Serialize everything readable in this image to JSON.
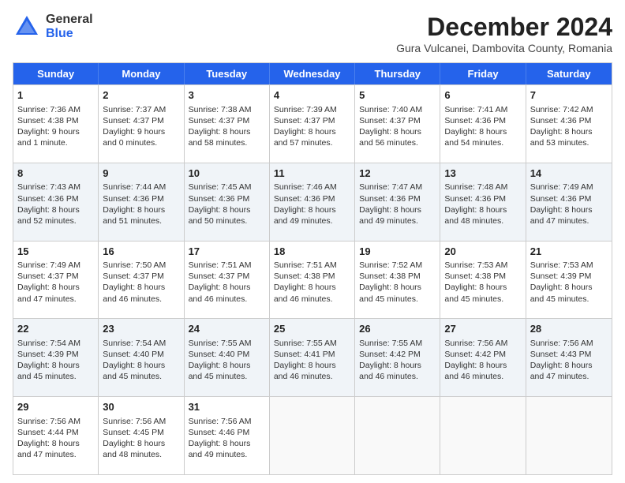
{
  "logo": {
    "general": "General",
    "blue": "Blue"
  },
  "title": "December 2024",
  "subtitle": "Gura Vulcanei, Dambovita County, Romania",
  "days": [
    "Sunday",
    "Monday",
    "Tuesday",
    "Wednesday",
    "Thursday",
    "Friday",
    "Saturday"
  ],
  "weeks": [
    [
      {
        "num": "1",
        "info": "Sunrise: 7:36 AM\nSunset: 4:38 PM\nDaylight: 9 hours\nand 1 minute.",
        "shade": false
      },
      {
        "num": "2",
        "info": "Sunrise: 7:37 AM\nSunset: 4:37 PM\nDaylight: 9 hours\nand 0 minutes.",
        "shade": false
      },
      {
        "num": "3",
        "info": "Sunrise: 7:38 AM\nSunset: 4:37 PM\nDaylight: 8 hours\nand 58 minutes.",
        "shade": false
      },
      {
        "num": "4",
        "info": "Sunrise: 7:39 AM\nSunset: 4:37 PM\nDaylight: 8 hours\nand 57 minutes.",
        "shade": false
      },
      {
        "num": "5",
        "info": "Sunrise: 7:40 AM\nSunset: 4:37 PM\nDaylight: 8 hours\nand 56 minutes.",
        "shade": false
      },
      {
        "num": "6",
        "info": "Sunrise: 7:41 AM\nSunset: 4:36 PM\nDaylight: 8 hours\nand 54 minutes.",
        "shade": false
      },
      {
        "num": "7",
        "info": "Sunrise: 7:42 AM\nSunset: 4:36 PM\nDaylight: 8 hours\nand 53 minutes.",
        "shade": false
      }
    ],
    [
      {
        "num": "8",
        "info": "Sunrise: 7:43 AM\nSunset: 4:36 PM\nDaylight: 8 hours\nand 52 minutes.",
        "shade": true
      },
      {
        "num": "9",
        "info": "Sunrise: 7:44 AM\nSunset: 4:36 PM\nDaylight: 8 hours\nand 51 minutes.",
        "shade": true
      },
      {
        "num": "10",
        "info": "Sunrise: 7:45 AM\nSunset: 4:36 PM\nDaylight: 8 hours\nand 50 minutes.",
        "shade": true
      },
      {
        "num": "11",
        "info": "Sunrise: 7:46 AM\nSunset: 4:36 PM\nDaylight: 8 hours\nand 49 minutes.",
        "shade": true
      },
      {
        "num": "12",
        "info": "Sunrise: 7:47 AM\nSunset: 4:36 PM\nDaylight: 8 hours\nand 49 minutes.",
        "shade": true
      },
      {
        "num": "13",
        "info": "Sunrise: 7:48 AM\nSunset: 4:36 PM\nDaylight: 8 hours\nand 48 minutes.",
        "shade": true
      },
      {
        "num": "14",
        "info": "Sunrise: 7:49 AM\nSunset: 4:36 PM\nDaylight: 8 hours\nand 47 minutes.",
        "shade": true
      }
    ],
    [
      {
        "num": "15",
        "info": "Sunrise: 7:49 AM\nSunset: 4:37 PM\nDaylight: 8 hours\nand 47 minutes.",
        "shade": false
      },
      {
        "num": "16",
        "info": "Sunrise: 7:50 AM\nSunset: 4:37 PM\nDaylight: 8 hours\nand 46 minutes.",
        "shade": false
      },
      {
        "num": "17",
        "info": "Sunrise: 7:51 AM\nSunset: 4:37 PM\nDaylight: 8 hours\nand 46 minutes.",
        "shade": false
      },
      {
        "num": "18",
        "info": "Sunrise: 7:51 AM\nSunset: 4:38 PM\nDaylight: 8 hours\nand 46 minutes.",
        "shade": false
      },
      {
        "num": "19",
        "info": "Sunrise: 7:52 AM\nSunset: 4:38 PM\nDaylight: 8 hours\nand 45 minutes.",
        "shade": false
      },
      {
        "num": "20",
        "info": "Sunrise: 7:53 AM\nSunset: 4:38 PM\nDaylight: 8 hours\nand 45 minutes.",
        "shade": false
      },
      {
        "num": "21",
        "info": "Sunrise: 7:53 AM\nSunset: 4:39 PM\nDaylight: 8 hours\nand 45 minutes.",
        "shade": false
      }
    ],
    [
      {
        "num": "22",
        "info": "Sunrise: 7:54 AM\nSunset: 4:39 PM\nDaylight: 8 hours\nand 45 minutes.",
        "shade": true
      },
      {
        "num": "23",
        "info": "Sunrise: 7:54 AM\nSunset: 4:40 PM\nDaylight: 8 hours\nand 45 minutes.",
        "shade": true
      },
      {
        "num": "24",
        "info": "Sunrise: 7:55 AM\nSunset: 4:40 PM\nDaylight: 8 hours\nand 45 minutes.",
        "shade": true
      },
      {
        "num": "25",
        "info": "Sunrise: 7:55 AM\nSunset: 4:41 PM\nDaylight: 8 hours\nand 46 minutes.",
        "shade": true
      },
      {
        "num": "26",
        "info": "Sunrise: 7:55 AM\nSunset: 4:42 PM\nDaylight: 8 hours\nand 46 minutes.",
        "shade": true
      },
      {
        "num": "27",
        "info": "Sunrise: 7:56 AM\nSunset: 4:42 PM\nDaylight: 8 hours\nand 46 minutes.",
        "shade": true
      },
      {
        "num": "28",
        "info": "Sunrise: 7:56 AM\nSunset: 4:43 PM\nDaylight: 8 hours\nand 47 minutes.",
        "shade": true
      }
    ],
    [
      {
        "num": "29",
        "info": "Sunrise: 7:56 AM\nSunset: 4:44 PM\nDaylight: 8 hours\nand 47 minutes.",
        "shade": false
      },
      {
        "num": "30",
        "info": "Sunrise: 7:56 AM\nSunset: 4:45 PM\nDaylight: 8 hours\nand 48 minutes.",
        "shade": false
      },
      {
        "num": "31",
        "info": "Sunrise: 7:56 AM\nSunset: 4:46 PM\nDaylight: 8 hours\nand 49 minutes.",
        "shade": false
      },
      {
        "num": "",
        "info": "",
        "shade": false,
        "empty": true
      },
      {
        "num": "",
        "info": "",
        "shade": false,
        "empty": true
      },
      {
        "num": "",
        "info": "",
        "shade": false,
        "empty": true
      },
      {
        "num": "",
        "info": "",
        "shade": false,
        "empty": true
      }
    ]
  ]
}
